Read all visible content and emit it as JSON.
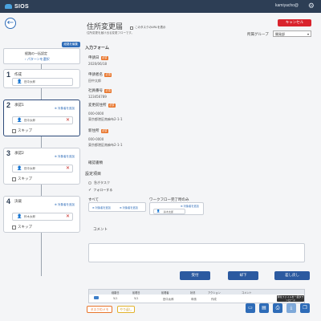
{
  "header": {
    "brand": "SIOS",
    "user": "kamiyacho@",
    "settings_icon": "gear-icon"
  },
  "page": {
    "title": "住所変更届",
    "description": "住所変更を届け出る変更フローです。",
    "url_checkbox_label": "このタスクのURLを表示",
    "cancel_label": "キャンセル",
    "group_label": "所属グループ",
    "group_value": "開発部"
  },
  "flow": {
    "header_label": "経路を編集",
    "common_title": "経路の一括設定",
    "common_link": "パターンを選択",
    "steps": [
      {
        "num": "1",
        "name": "作成",
        "person": "田中太郎",
        "add_label": "",
        "skip_label": ""
      },
      {
        "num": "2",
        "name": "承認1",
        "person": "田中太郎",
        "add_label": "対象者を追加",
        "skip_label": "スキップ"
      },
      {
        "num": "3",
        "name": "承認2",
        "person": "田中太郎",
        "add_label": "対象者を追加",
        "skip_label": "スキップ"
      },
      {
        "num": "4",
        "name": "決裁",
        "person": "鈴木太郎",
        "add_label": "対象者を追加",
        "skip_label": "スキップ"
      }
    ]
  },
  "form": {
    "section_title": "入力フォーム",
    "required_badge": "必須",
    "fields": [
      {
        "label": "申請日",
        "value": "2020/06/18"
      },
      {
        "label": "申請者名",
        "value": "田中太郎"
      },
      {
        "label": "社員番号",
        "value": "123456789"
      },
      {
        "label": "変更前住所",
        "value": "000-0000",
        "value2": "東京都港区南麻布2-1-1"
      },
      {
        "label": "新住所",
        "value": "000-0000",
        "value2": "東京都港区南麻布2-1-1"
      }
    ],
    "attachments_label": "確認書類"
  },
  "settings": {
    "section_title": "設定項目",
    "urgent_label": "急ぎタスク",
    "follow_label": "フォローする",
    "all_label": "すべて",
    "flow_end_label": "ワークフロー完了時のみ",
    "add_person_link": "対象者を追加",
    "add_group_link": "対象者を追加",
    "add_person_link2": "対象者を追加",
    "flow_end_person": "鈴木太郎"
  },
  "comment": {
    "label": "コメント"
  },
  "actions": {
    "accept": "受付",
    "reject": "却下",
    "send_back": "差し戻し"
  },
  "history": {
    "headers": [
      "経路日",
      "処理日",
      "処理者",
      "状況",
      "アクション",
      "コメント"
    ],
    "row": [
      "5/1",
      "5/1",
      "田中太郎",
      "申請",
      "作成",
      ""
    ]
  },
  "footer": {
    "task_memo": "タスクのメモ",
    "yarikake": "やり返し",
    "tooltip": "添付ファイルを一括ダウンロード"
  }
}
